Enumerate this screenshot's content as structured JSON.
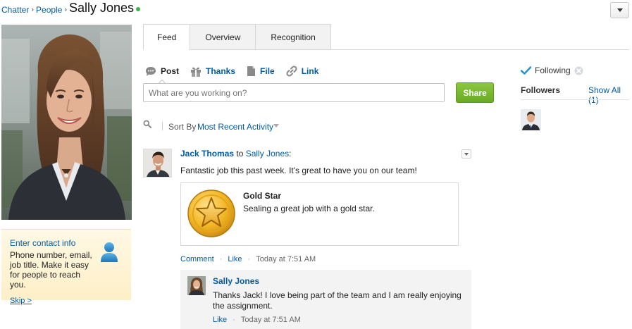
{
  "breadcrumb": {
    "items": [
      "Chatter",
      "People"
    ],
    "separator": "›"
  },
  "page_title": "Sally Jones",
  "presence_color": "#3bb44a",
  "contact": {
    "title": "Enter contact info",
    "text": "Phone number, email, job title. Make it easy for people to reach you.",
    "skip_label": "Skip >"
  },
  "tabs": [
    {
      "label": "Feed",
      "active": true
    },
    {
      "label": "Overview",
      "active": false
    },
    {
      "label": "Recognition",
      "active": false
    }
  ],
  "publisher": {
    "actions": [
      {
        "label": "Post",
        "icon": "speech-bubble-icon"
      },
      {
        "label": "Thanks",
        "icon": "gift-icon"
      },
      {
        "label": "File",
        "icon": "document-icon"
      },
      {
        "label": "Link",
        "icon": "chain-link-icon"
      }
    ],
    "placeholder": "What are you working on?",
    "share_label": "Share"
  },
  "sort": {
    "label": "Sort By",
    "value": "Most Recent Activity"
  },
  "post": {
    "author": "Jack Thomas",
    "to_word": "to",
    "target": "Sally Jones",
    "colon": ":",
    "body": "Fantastic job this past week. It's great to have you on our team!",
    "badge": {
      "title": "Gold Star",
      "description": "Sealing a great job with a gold star."
    },
    "footer": {
      "comment": "Comment",
      "like": "Like",
      "timestamp": "Today at 7:51 AM"
    }
  },
  "comment": {
    "author": "Sally Jones",
    "text": "Thanks Jack! I love being part of the team and I am really enjoying the assignment.",
    "like": "Like",
    "timestamp": "Today at 7:51 AM"
  },
  "sidebar": {
    "following_label": "Following",
    "followers_title": "Followers",
    "show_all": "Show All (1)"
  },
  "colors": {
    "link": "#015ba7",
    "share_button": "#7ab833",
    "following_check": "#2a94d6"
  }
}
